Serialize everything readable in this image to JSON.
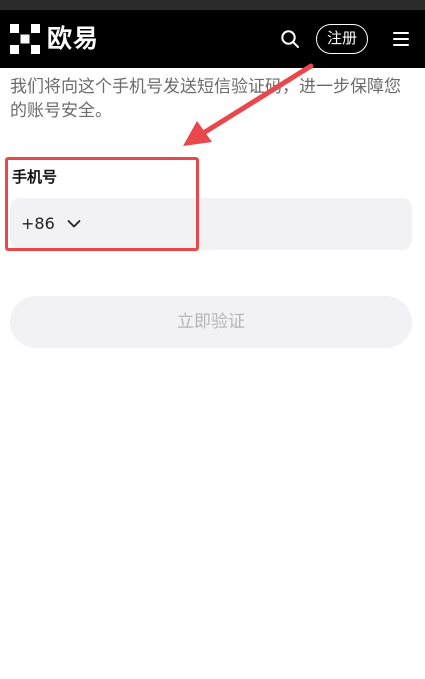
{
  "header": {
    "logo_text": "欧易",
    "logo_icon": "okx-logo-icon",
    "search_icon": "search-icon",
    "register_label": "注册",
    "menu_icon": "hamburger-menu-icon",
    "background": "#000000"
  },
  "main": {
    "description": "我们将向这个手机号发送短信验证码，进一步保障您的账号安全。",
    "phone_label": "手机号",
    "country_code": "+86",
    "country_code_icon": "chevron-down-icon",
    "phone_value": "",
    "verify_button_label": "立即验证"
  },
  "annotation": {
    "color": "#e8474b"
  }
}
